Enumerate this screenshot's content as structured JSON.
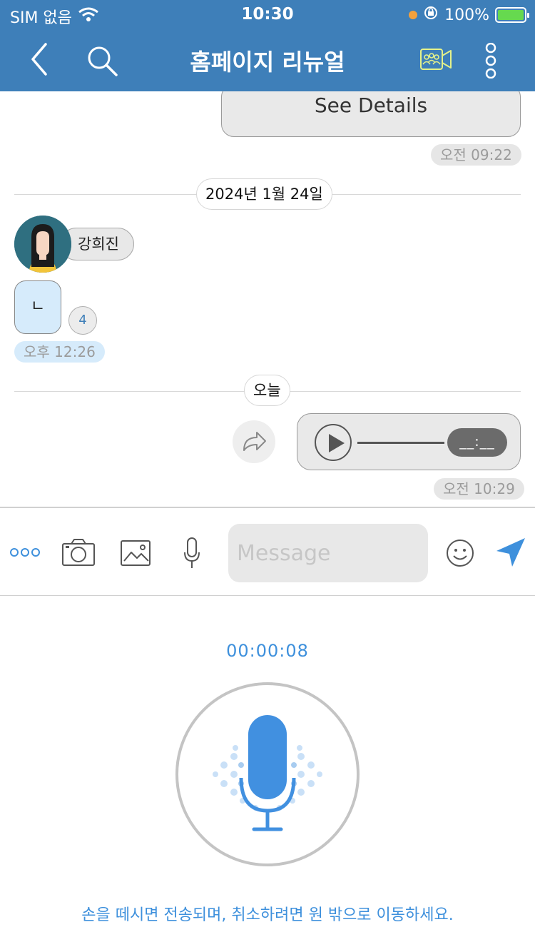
{
  "status": {
    "carrier": "SIM 없음",
    "time": "10:30",
    "battery": "100%"
  },
  "header": {
    "title": "홈페이지 리뉴얼"
  },
  "chat": {
    "details_button": "See Details",
    "time_1": "오전 09:22",
    "date_1": "2024년 1월 24일",
    "sender_name": "강희진",
    "jamo_message": "ㄴ",
    "unread_count": "4",
    "time_2": "오후 12:26",
    "date_2": "오늘",
    "voice_duration": "__:__",
    "time_3": "오전 10:29"
  },
  "input": {
    "placeholder": "Message"
  },
  "recorder": {
    "timer": "00:00:08",
    "hint": "손을 떼시면 전송되며, 취소하려면 원 밖으로 이동하세요."
  },
  "colors": {
    "header_bg": "#3e7fb9",
    "accent": "#3e90dc",
    "mic": "#4190e0"
  }
}
